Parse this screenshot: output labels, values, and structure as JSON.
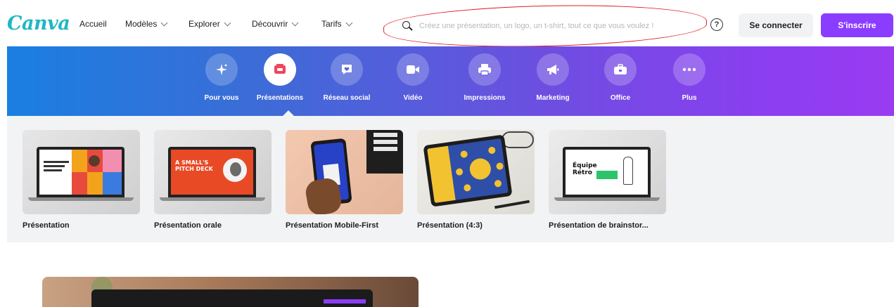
{
  "header": {
    "logo": "Canva",
    "nav": [
      {
        "label": "Accueil",
        "has_menu": false
      },
      {
        "label": "Modèles",
        "has_menu": true
      },
      {
        "label": "Explorer",
        "has_menu": true
      },
      {
        "label": "Découvrir",
        "has_menu": true
      },
      {
        "label": "Tarifs",
        "has_menu": true
      }
    ],
    "search": {
      "placeholder": "Créez une présentation, un logo, un t-shirt, tout ce que vous voulez !",
      "value": ""
    },
    "help_glyph": "?",
    "login_label": "Se connecter",
    "signup_label": "S'inscrire"
  },
  "categories": [
    {
      "label": "Pour vous",
      "icon": "sparkle-icon",
      "active": false
    },
    {
      "label": "Présentations",
      "icon": "presentation-icon",
      "active": true
    },
    {
      "label": "Réseau social",
      "icon": "heart-chat-icon",
      "active": false
    },
    {
      "label": "Vidéo",
      "icon": "video-camera-icon",
      "active": false
    },
    {
      "label": "Impressions",
      "icon": "printer-icon",
      "active": false
    },
    {
      "label": "Marketing",
      "icon": "megaphone-icon",
      "active": false
    },
    {
      "label": "Office",
      "icon": "briefcase-icon",
      "active": false
    },
    {
      "label": "Plus",
      "icon": "more-dots-icon",
      "active": false
    }
  ],
  "templates": [
    {
      "label": "Présentation"
    },
    {
      "label": "Présentation orale",
      "thumb_text": "A SMALL'S PITCH DECK"
    },
    {
      "label": "Présentation Mobile-First"
    },
    {
      "label": "Présentation (4:3)"
    },
    {
      "label": "Présentation de brainstor...",
      "thumb_text": "Équipe Rétro"
    }
  ],
  "colors": {
    "brand_purple": "#8b3dff",
    "logo_teal": "#20b7c4",
    "annotation_red": "#e31b23"
  }
}
